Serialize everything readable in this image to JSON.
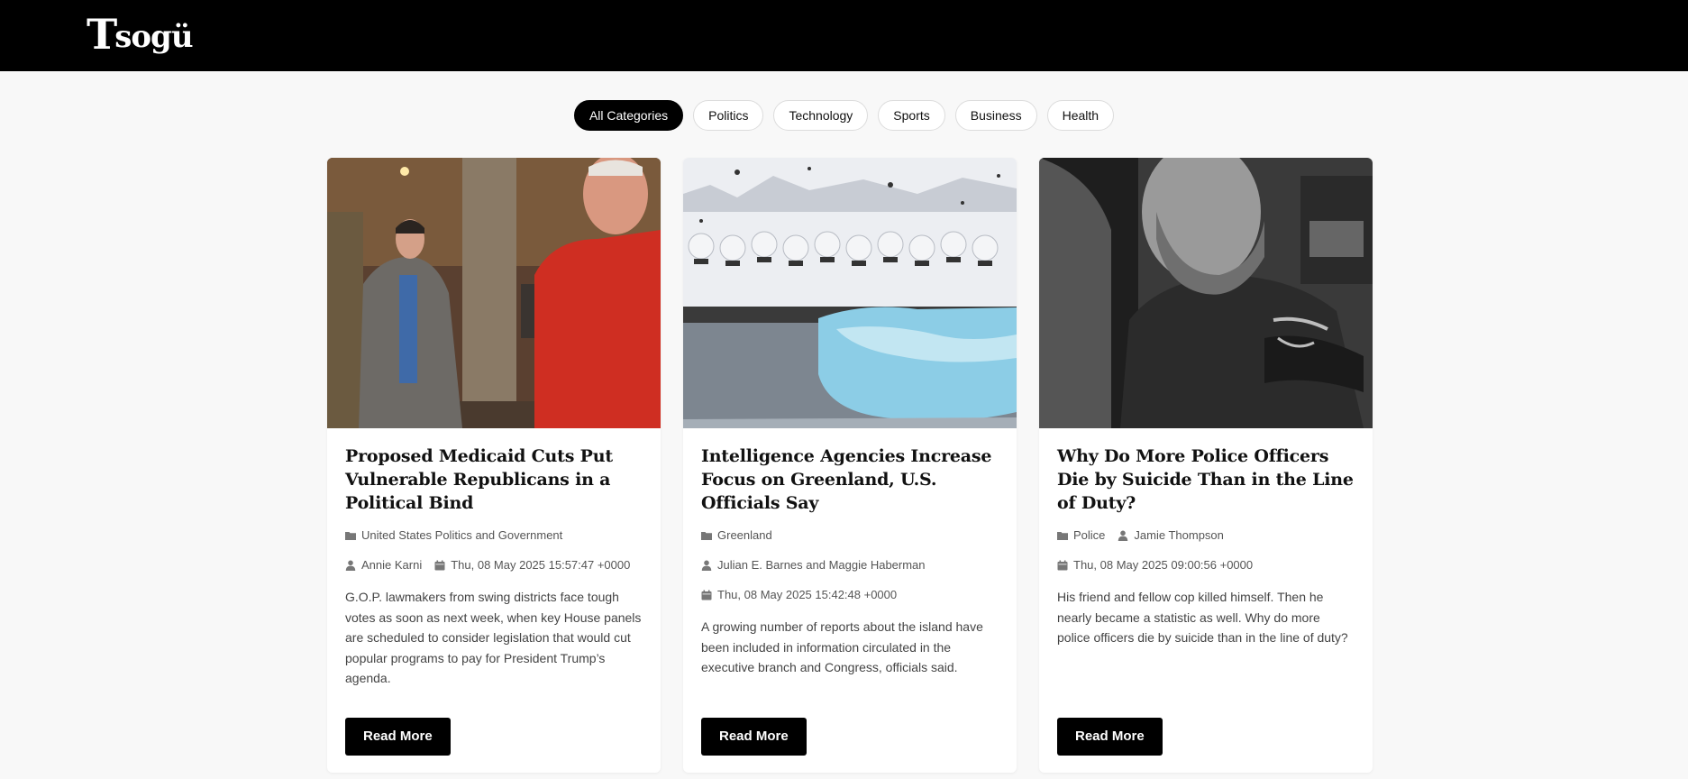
{
  "header": {
    "logo_initial": "T",
    "logo_rest": "sogü"
  },
  "filters": [
    {
      "label": "All Categories",
      "active": true
    },
    {
      "label": "Politics",
      "active": false
    },
    {
      "label": "Technology",
      "active": false
    },
    {
      "label": "Sports",
      "active": false
    },
    {
      "label": "Business",
      "active": false
    },
    {
      "label": "Health",
      "active": false
    }
  ],
  "articles": [
    {
      "title": "Proposed Medicaid Cuts Put Vulnerable Republicans in a Political Bind",
      "category": "United States Politics and Government",
      "author": "Annie Karni",
      "date": "Thu, 08 May 2025 15:57:47 +0000",
      "summary": "G.O.P. lawmakers from swing districts face tough votes as soon as next week, when key House panels are scheduled to consider legislation that would cut popular programs to pay for President Trump’s agenda.",
      "button": "Read More"
    },
    {
      "title": "Intelligence Agencies Increase Focus on Greenland, U.S. Officials Say",
      "category": "Greenland",
      "author": "Julian E. Barnes and Maggie Haberman",
      "date": "Thu, 08 May 2025 15:42:48 +0000",
      "summary": "A growing number of reports about the island have been included in information circulated in the executive branch and Congress, officials said.",
      "button": "Read More"
    },
    {
      "title": "Why Do More Police Officers Die by Suicide Than in the Line of Duty?",
      "category": "Police",
      "author": "Jamie Thompson",
      "date": "Thu, 08 May 2025 09:00:56 +0000",
      "summary": "His friend and fellow cop killed himself. Then he nearly became a statistic as well. Why do more police officers die by suicide than in the line of duty?",
      "button": "Read More"
    }
  ]
}
